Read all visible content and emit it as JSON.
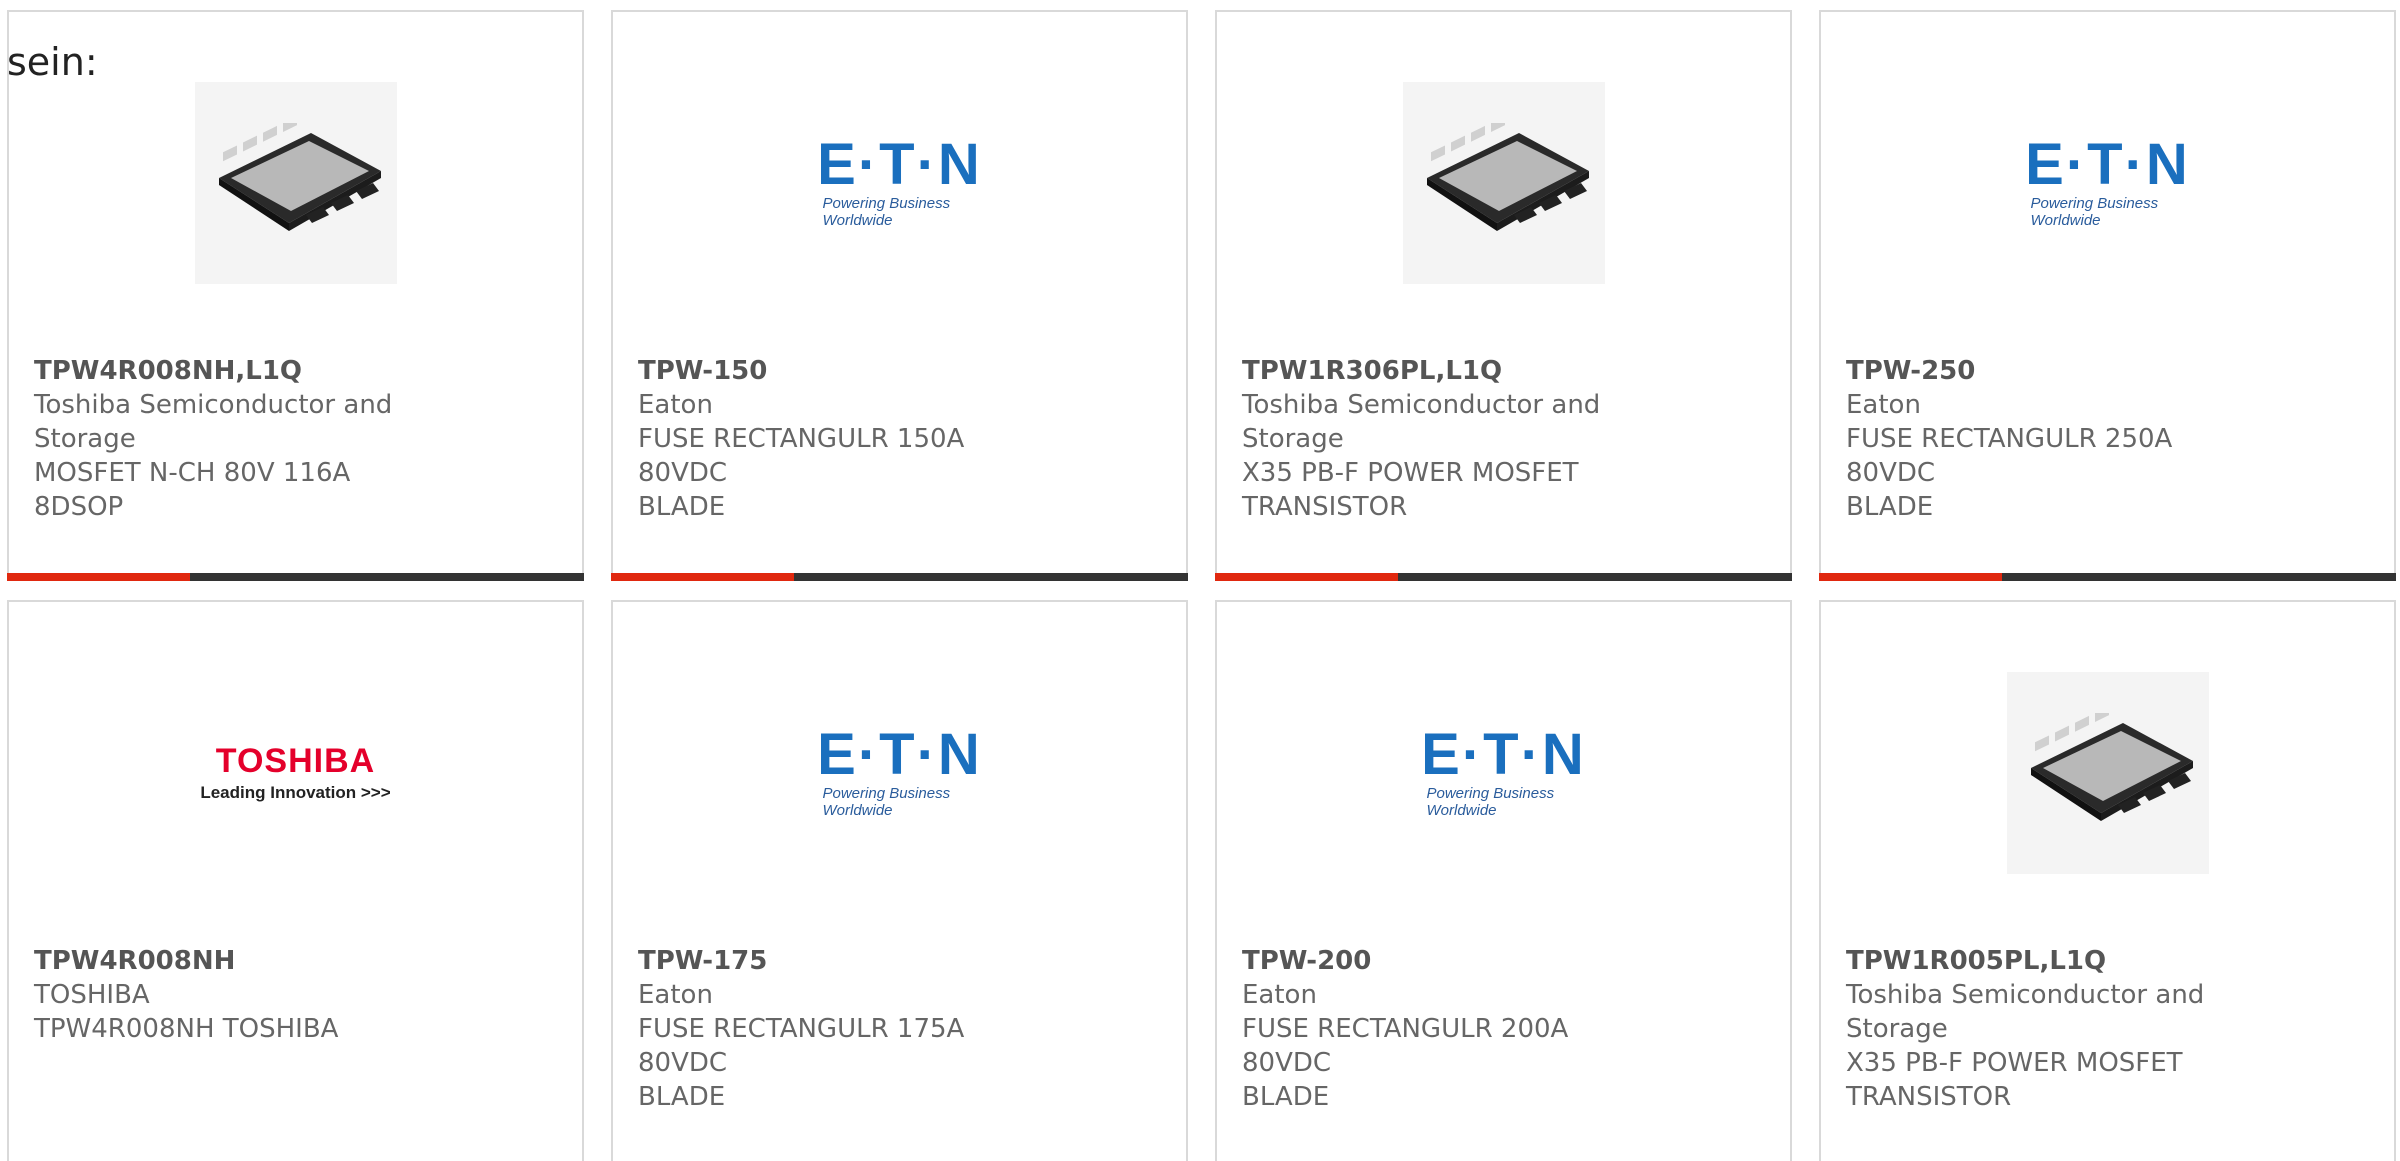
{
  "intro_text": "sein:",
  "products": [
    {
      "part_number": "TPW4R008NH,L1Q",
      "manufacturer_line1": "Toshiba Semiconductor and",
      "manufacturer_line2": "Storage",
      "desc_line1": "MOSFET N-CH 80V 116A 8DSOP",
      "desc_line2": "",
      "image": "mosfet-chip"
    },
    {
      "part_number": "TPW-150",
      "manufacturer_line1": "Eaton",
      "manufacturer_line2": "",
      "desc_line1": "FUSE RECTANGULR 150A 80VDC",
      "desc_line2": "BLADE",
      "image": "eaton-logo"
    },
    {
      "part_number": "TPW1R306PL,L1Q",
      "manufacturer_line1": "Toshiba Semiconductor and",
      "manufacturer_line2": "Storage",
      "desc_line1": "X35 PB-F POWER MOSFET",
      "desc_line2": "TRANSISTOR",
      "image": "mosfet-chip"
    },
    {
      "part_number": "TPW-250",
      "manufacturer_line1": "Eaton",
      "manufacturer_line2": "",
      "desc_line1": "FUSE RECTANGULR 250A 80VDC",
      "desc_line2": "BLADE",
      "image": "eaton-logo"
    },
    {
      "part_number": "TPW4R008NH",
      "manufacturer_line1": "TOSHIBA",
      "manufacturer_line2": "",
      "desc_line1": "TPW4R008NH TOSHIBA",
      "desc_line2": "",
      "image": "toshiba-logo"
    },
    {
      "part_number": "TPW-175",
      "manufacturer_line1": "Eaton",
      "manufacturer_line2": "",
      "desc_line1": "FUSE RECTANGULR 175A 80VDC",
      "desc_line2": "BLADE",
      "image": "eaton-logo"
    },
    {
      "part_number": "TPW-200",
      "manufacturer_line1": "Eaton",
      "manufacturer_line2": "",
      "desc_line1": "FUSE RECTANGULR 200A 80VDC",
      "desc_line2": "BLADE",
      "image": "eaton-logo"
    },
    {
      "part_number": "TPW1R005PL,L1Q",
      "manufacturer_line1": "Toshiba Semiconductor and",
      "manufacturer_line2": "Storage",
      "desc_line1": "X35 PB-F POWER MOSFET",
      "desc_line2": "TRANSISTOR",
      "image": "mosfet-chip"
    }
  ],
  "logos": {
    "eaton_word": "E·T·N",
    "eaton_tagline": "Powering Business Worldwide",
    "toshiba_word": "TOSHIBA",
    "toshiba_tagline": "Leading Innovation >>>"
  },
  "colors": {
    "accent": "#e0280f",
    "bar": "#333333",
    "eaton_blue": "#1a6fbe",
    "toshiba_red": "#e4002b"
  }
}
